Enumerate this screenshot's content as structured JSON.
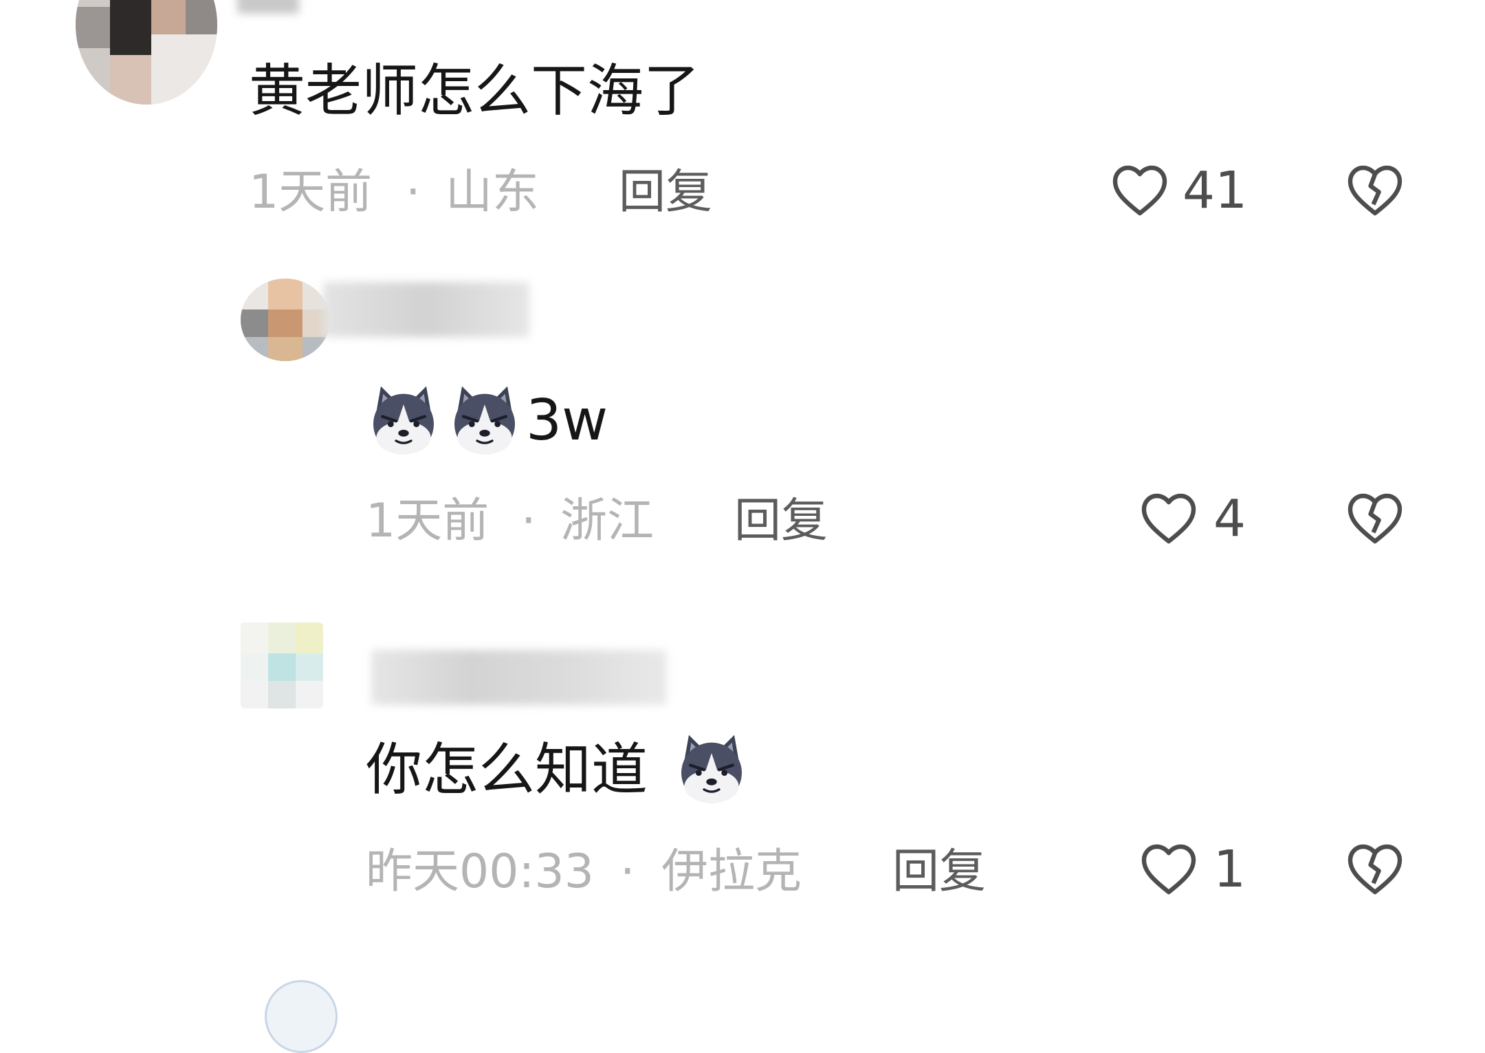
{
  "comments": [
    {
      "text": "黄老师怎么下海了",
      "time": "1天前",
      "location": "山东",
      "reply_label": "回复",
      "like_count": "41",
      "like_icon": "heart-outline-icon",
      "dislike_icon": "broken-heart-icon"
    },
    {
      "text_suffix": "3w",
      "emoji": "husky-emoji",
      "time": "1天前",
      "location": "浙江",
      "reply_label": "回复",
      "like_count": "4",
      "like_icon": "heart-outline-icon",
      "dislike_icon": "broken-heart-icon"
    },
    {
      "text": "你怎么知道",
      "emoji": "husky-emoji",
      "time": "昨天00:33",
      "location": "伊拉克",
      "reply_label": "回复",
      "like_count": "1",
      "like_icon": "heart-outline-icon",
      "dislike_icon": "broken-heart-icon"
    }
  ],
  "separator": "·",
  "colors": {
    "text": "#161616",
    "meta": "#b4b4b4",
    "reply": "#5c5c5c",
    "icon": "#4d4d4d",
    "background": "#ffffff"
  }
}
